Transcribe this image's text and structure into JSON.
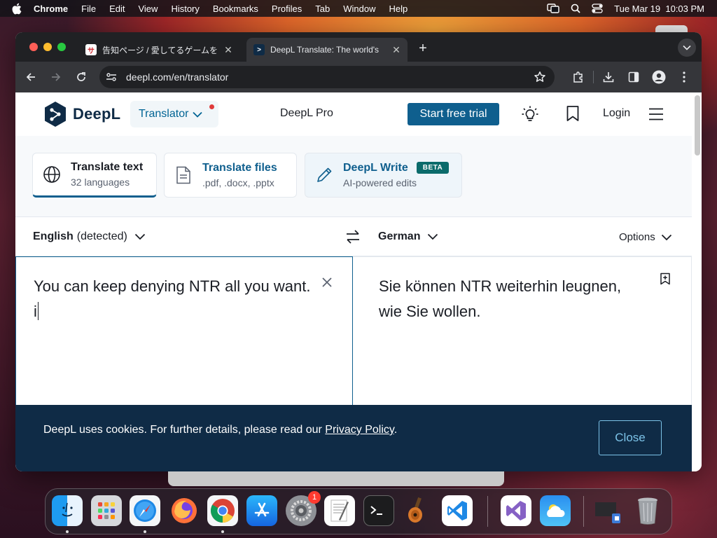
{
  "menubar": {
    "app": "Chrome",
    "items": [
      "File",
      "Edit",
      "View",
      "History",
      "Bookmarks",
      "Profiles",
      "Tab",
      "Window",
      "Help"
    ],
    "datetime": "Tue Mar 19  10:03 PM"
  },
  "tabs": [
    {
      "title": "告知ページ / 愛してるゲームを",
      "favicon": "サ",
      "active": false
    },
    {
      "title": "DeepL Translate: The world's",
      "active": true
    }
  ],
  "address_bar": {
    "url": "deepl.com/en/translator"
  },
  "deepl": {
    "logo_text": "DeepL",
    "translator_label": "Translator",
    "pro_label": "DeepL Pro",
    "start_trial_label": "Start free trial",
    "login_label": "Login",
    "modes": [
      {
        "title": "Translate text",
        "subtitle": "32 languages"
      },
      {
        "title": "Translate files",
        "subtitle": ".pdf, .docx, .pptx"
      },
      {
        "title": "DeepL Write",
        "subtitle": "AI-powered edits",
        "badge": "BETA"
      }
    ],
    "source_language": "English",
    "source_detected": "(detected)",
    "target_language": "German",
    "options_label": "Options",
    "source_text": "You can keep denying NTR all you want. i",
    "target_text": "Sie können NTR weiterhin leugnen, wie Sie wollen.",
    "accent_color": "#0f5f8e",
    "navy_color": "#0f2b46"
  },
  "cookie_banner": {
    "message": "DeepL uses cookies. For further details, please read our ",
    "link": "Privacy Policy",
    "suffix": ".",
    "close_label": "Close"
  },
  "dock": {
    "apps": [
      "finder-icon",
      "launchpad-icon",
      "safari-icon",
      "firefox-icon",
      "chrome-icon",
      "app-store-icon",
      "system-settings-icon",
      "textedit-icon",
      "terminal-icon",
      "garageband-icon",
      "vscode-icon",
      "visual-studio-icon",
      "weather-icon",
      "downloads-stack-icon",
      "trash-icon"
    ],
    "settings_badge": "1"
  }
}
